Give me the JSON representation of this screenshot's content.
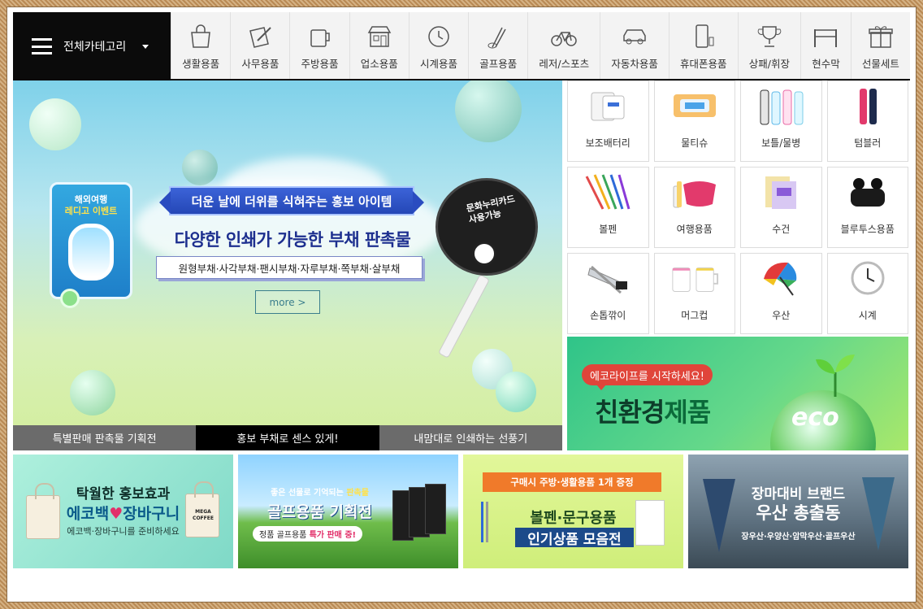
{
  "category_bar": {
    "all_label": "전체카테고리",
    "items": [
      {
        "label": "생활용품",
        "icon": "shopping-bag-icon"
      },
      {
        "label": "사무용품",
        "icon": "pen-paper-icon"
      },
      {
        "label": "주방용품",
        "icon": "mug-icon"
      },
      {
        "label": "업소용품",
        "icon": "store-icon"
      },
      {
        "label": "시계용품",
        "icon": "clock-icon"
      },
      {
        "label": "골프용품",
        "icon": "golf-club-icon"
      },
      {
        "label": "레저/스포츠",
        "icon": "bicycle-icon"
      },
      {
        "label": "자동차용품",
        "icon": "car-icon"
      },
      {
        "label": "휴대폰용품",
        "icon": "phone-icon"
      },
      {
        "label": "상패/휘장",
        "icon": "trophy-icon"
      },
      {
        "label": "현수막",
        "icon": "banner-icon"
      },
      {
        "label": "선물세트",
        "icon": "gift-icon"
      }
    ]
  },
  "hero": {
    "ribbon": "더운 날에 더위를 식혀주는 홍보 아이템",
    "title": "다양한 인쇄가 가능한 부채 판촉물",
    "subtitle": "원형부채·사각부채·팬시부채·자루부채·쪽부채·살부채",
    "more": "more >",
    "card_line1": "해외여행",
    "card_line2": "레디고 이벤트",
    "fan_line1": "문화누리카드",
    "fan_line2": "사용가능",
    "tabs": [
      "특별판매 판촉물 기획전",
      "홍보 부채로 센스 있게!",
      "내맘대로 인쇄하는 선풍기"
    ],
    "active_tab": 1
  },
  "grid": [
    {
      "label": "보조배터리",
      "icon": "battery-pack-icon"
    },
    {
      "label": "물티슈",
      "icon": "wet-tissue-icon"
    },
    {
      "label": "보틀/물병",
      "icon": "bottle-icon"
    },
    {
      "label": "텀블러",
      "icon": "tumbler-icon"
    },
    {
      "label": "볼펜",
      "icon": "ballpen-icon"
    },
    {
      "label": "여행용품",
      "icon": "travel-kit-icon"
    },
    {
      "label": "수건",
      "icon": "towel-icon"
    },
    {
      "label": "블루투스용품",
      "icon": "earbuds-icon"
    },
    {
      "label": "손톱깎이",
      "icon": "nail-clipper-icon"
    },
    {
      "label": "머그컵",
      "icon": "mug-cup-icon"
    },
    {
      "label": "우산",
      "icon": "umbrella-icon"
    },
    {
      "label": "시계",
      "icon": "wall-clock-icon"
    }
  ],
  "eco_banner": {
    "pill": "에코라이프를 시작하세요!",
    "title_a": "친환경",
    "title_b": "제품",
    "globe_text": "eco"
  },
  "bottom_banners": [
    {
      "line1": "탁월한 홍보효과",
      "line2a": "에코백",
      "line2b": "장바구니",
      "line3": "에코백·장바구니를 준비하세요",
      "bag_text": "MEGA COFFEE"
    },
    {
      "line1a": "좋은 선물로 기억되는 ",
      "line1b": "판촉물",
      "line2": "골프용품 기획전",
      "line3a": "정품 골프용품 ",
      "line3b": "특가 판매 중!"
    },
    {
      "badge": "구매시 주방·생활용품 1개 증정",
      "line2": "볼펜·문구용품",
      "line3": "인기상품 모음전"
    },
    {
      "line1": "장마대비 브랜드",
      "line2": "우산 총출동",
      "line3": "장우산·우양산·암막우산·골프우산"
    }
  ]
}
